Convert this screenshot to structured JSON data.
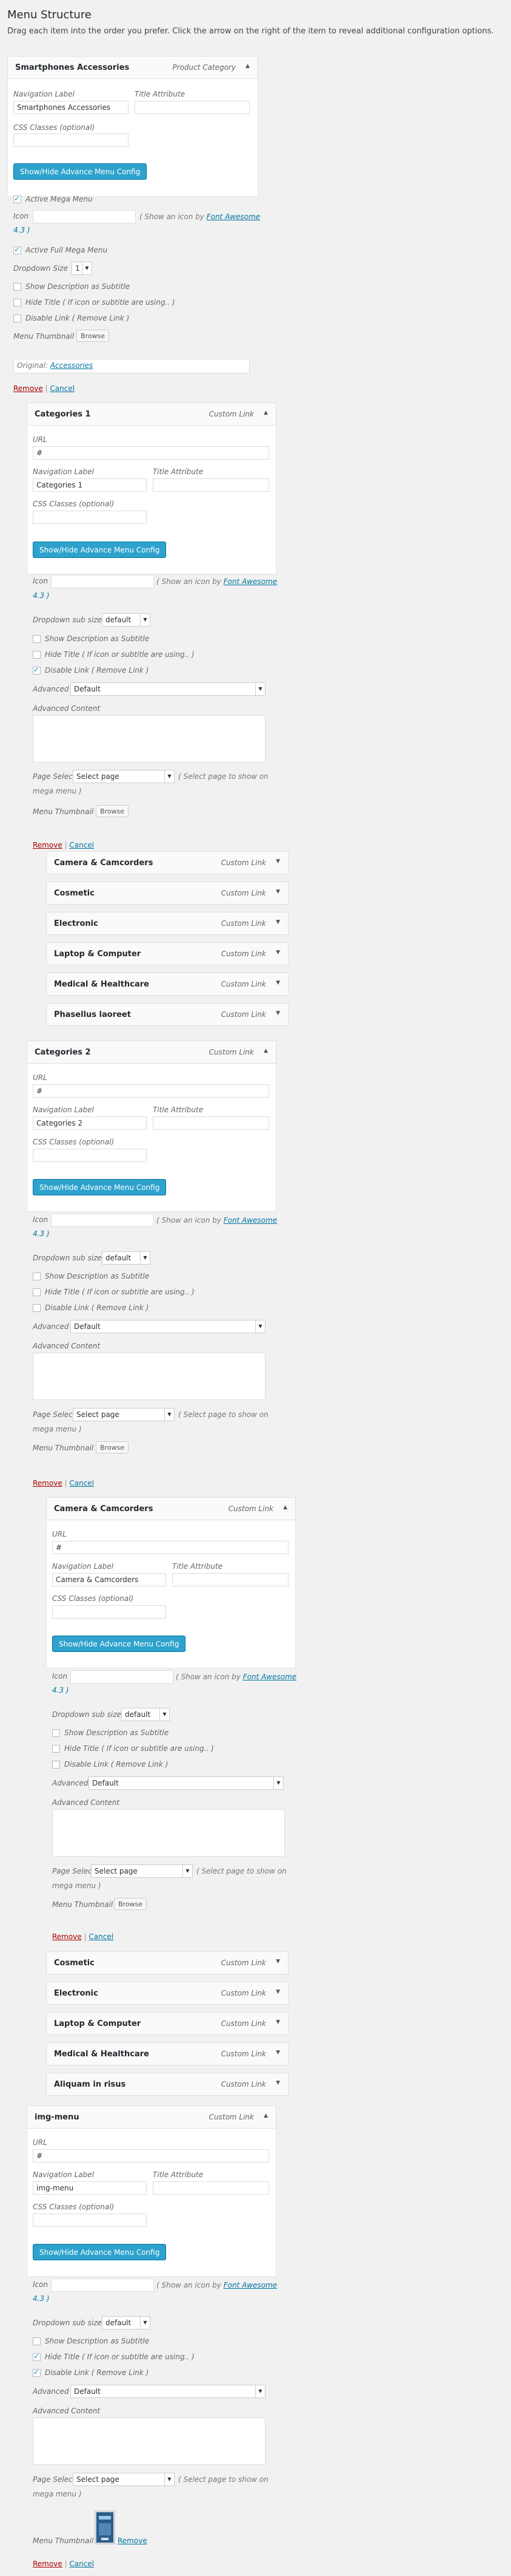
{
  "page": {
    "title": "Menu Structure",
    "instructions": "Drag each item into the order you prefer. Click the arrow on the right of the item to reveal additional configuration options."
  },
  "labels": {
    "url": "URL",
    "nav": "Navigation Label",
    "title_attr": "Title Attribute",
    "css": "CSS Classes (optional)",
    "config": "Show/Hide Advance Menu Config",
    "icon": "Icon",
    "icon_hint": "( Show an icon by ",
    "font_awesome": "Font Awesome",
    "fa_version": "4.3 )",
    "dropdown_size": "Dropdown Size",
    "dropdown_sub": "Dropdown sub size",
    "show_desc": "Show Description as Subtitle",
    "hide_title": "Hide Title ( If icon or subtitle are using.. )",
    "disable_link": "Disable Link ( Remove Link )",
    "advanced": "Advanced",
    "advanced_content": "Advanced Content",
    "page_select": "Page Select",
    "page_select_hint": "( Select page to show on",
    "mega_menu": "mega menu )",
    "thumbnail": "Menu Thumbnail",
    "browse": "Browse",
    "remove": "Remove",
    "cancel": "Cancel",
    "sep": "|",
    "arrow": "▲",
    "arrow_down": "▼",
    "sel_arrow": "▼",
    "custom_link": "Custom Link",
    "active_mega": "Active Mega Menu",
    "active_full": "Active Full Mega Menu",
    "original": "Original:",
    "original_link": "Accessories",
    "default": "Default",
    "select_page": "Select page",
    "hash": "#"
  },
  "item_smartphones": {
    "title": "Smartphones Accessories",
    "type": "Product Category",
    "nav_value": "Smartphones Accessories",
    "dropdown_size_value": "1"
  },
  "item_cat1": {
    "title": "Categories 1",
    "nav_value": "Categories 1",
    "sub_size": "default",
    "children": [
      "Camera & Camcorders",
      "Cosmetic",
      "Electronic",
      "Laptop & Computer",
      "Medical & Healthcare",
      "Phasellus laoreet"
    ]
  },
  "item_cat2": {
    "title": "Categories 2",
    "nav_value": "Categories 2",
    "sub_size": "default"
  },
  "item_camera": {
    "title": "Camera & Camcorders",
    "nav_value": "Camera & Camcorders",
    "sub_size": "default",
    "siblings": [
      "Cosmetic",
      "Electronic",
      "Laptop & Computer",
      "Medical & Healthcare",
      "Aliquam in risus"
    ]
  },
  "item_img": {
    "title": "img-menu",
    "nav_value": "img-menu",
    "sub_size": "default",
    "remove_thumb": "Remove"
  }
}
